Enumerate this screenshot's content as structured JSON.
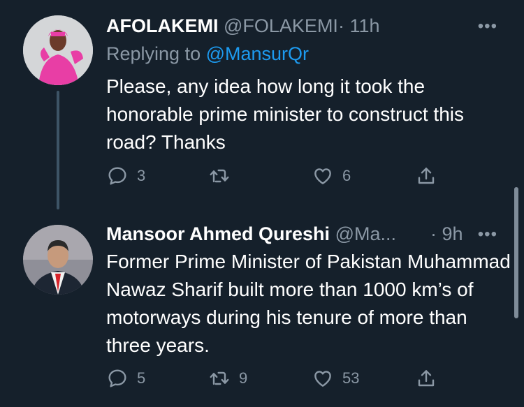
{
  "tweet1": {
    "name": "AFOLAKEMI",
    "handle": "@FOLAKEMI",
    "time": "· 11h",
    "more": "•••",
    "replying_prefix": "Replying to ",
    "replying_to": "@MansurQr",
    "text": "Please, any idea how long it took the honorable prime minister to construct this road? Thanks",
    "replies": "3",
    "retweets": "",
    "likes": "6"
  },
  "tweet2": {
    "name": "Mansoor Ahmed Qureshi",
    "handle": "@Ma...",
    "time": "· 9h",
    "more": "•••",
    "text": "Former Prime Minister of Pakistan Muhammad Nawaz Sharif built more than 1000 km’s of motorways during his tenure of more than three years.",
    "replies": "5",
    "retweets": "9",
    "likes": "53"
  },
  "colors": {
    "background": "#15202b",
    "secondary_text": "#8b98a5",
    "link": "#1d9bf0"
  }
}
